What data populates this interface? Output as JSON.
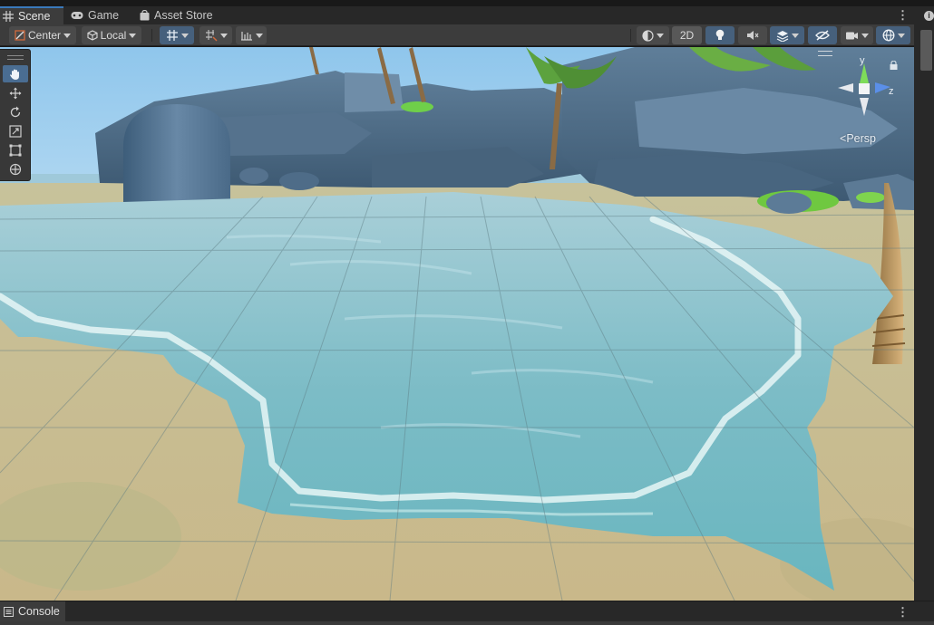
{
  "tabs": [
    {
      "label": "Scene",
      "icon": "grid-icon",
      "active": true
    },
    {
      "label": "Game",
      "icon": "gamepad-icon",
      "active": false
    },
    {
      "label": "Asset Store",
      "icon": "bag-icon",
      "active": false
    }
  ],
  "toolbar": {
    "pivot_label": "Center",
    "space_label": "Local",
    "toggle_2d": "2D"
  },
  "gizmo": {
    "axis_y": "y",
    "axis_z": "z",
    "projection_label": "Persp"
  },
  "console": {
    "label": "Console"
  },
  "colors": {
    "accent": "#3a79bb",
    "panel": "#3c3c3c",
    "tab_bar": "#282828",
    "water": "#6fb6c2",
    "sand": "#c8b98f",
    "rock": "#4d6a85",
    "sky": "#cfe6f3"
  }
}
